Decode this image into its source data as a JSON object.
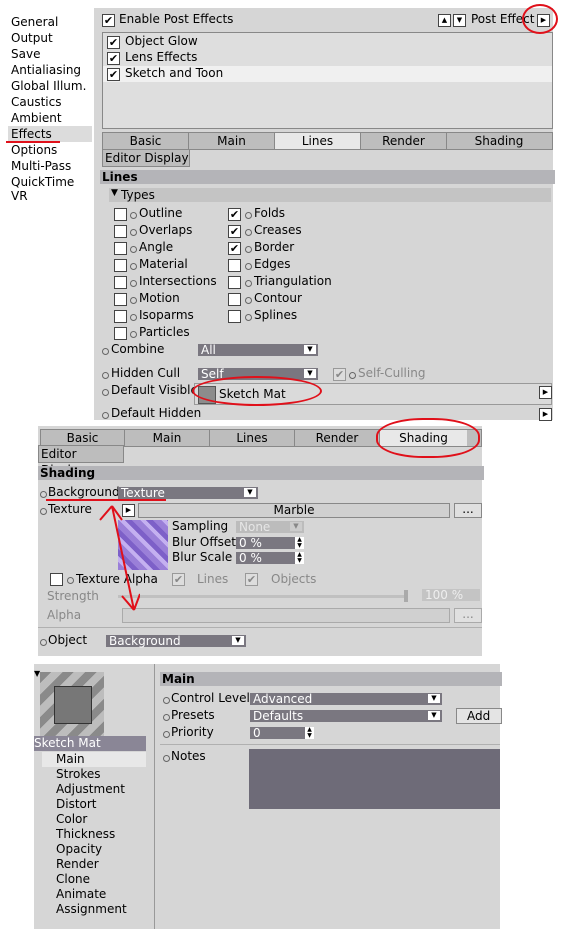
{
  "panel1": {
    "sidebar": [
      "General",
      "Output",
      "Save",
      "Antialiasing",
      "Global Illum.",
      "Caustics",
      "Ambient Occl.",
      "Effects",
      "Options",
      "Multi-Pass",
      "QuickTime VR"
    ],
    "enable_post_effects": "Enable Post Effects",
    "post_effect_label": "Post Effect",
    "effects_list": [
      "Object Glow",
      "Lens Effects",
      "Sketch and Toon"
    ],
    "tabs": [
      "Basic",
      "Main",
      "Lines",
      "Render",
      "Shading"
    ],
    "editor_display": "Editor Display",
    "section_title": "Lines",
    "types_label": "Types",
    "types_col1": [
      "Outline",
      "Overlaps",
      "Angle",
      "Material",
      "Intersections",
      "Motion",
      "Isoparms",
      "Particles"
    ],
    "types_col2": [
      "Folds",
      "Creases",
      "Border",
      "Edges",
      "Triangulation",
      "Contour",
      "Splines"
    ],
    "combine_label": "Combine",
    "combine_value": "All",
    "hidden_cull_label": "Hidden Cull",
    "hidden_cull_value": "Self",
    "self_culling": "Self-Culling",
    "default_visible_label": "Default Visible",
    "default_visible_value": "Sketch Mat",
    "default_hidden_label": "Default Hidden"
  },
  "panel2": {
    "tabs": [
      "Basic",
      "Main",
      "Lines",
      "Render",
      "Shading"
    ],
    "editor_display": "Editor Display",
    "section_title": "Shading",
    "background_label": "Background",
    "background_value": "Texture",
    "texture_label": "Texture",
    "texture_value": "Marble",
    "ellipsis": "...",
    "sampling_label": "Sampling",
    "sampling_value": "None",
    "blur_offset_label": "Blur Offset",
    "blur_offset_value": "0 %",
    "blur_scale_label": "Blur Scale",
    "blur_scale_value": "0 %",
    "texture_alpha": "Texture Alpha",
    "lines_label": "Lines",
    "objects_label": "Objects",
    "strength_label": "Strength",
    "strength_value": "100 %",
    "alpha_label": "Alpha",
    "object_label": "Object",
    "object_value": "Background"
  },
  "panel3": {
    "material_name": "Sketch Mat",
    "channels": [
      "Main",
      "Strokes",
      "Adjustment",
      "Distort",
      "Color",
      "Thickness",
      "Opacity",
      "Render",
      "Clone",
      "Animate",
      "Assignment"
    ],
    "section_title": "Main",
    "control_level_label": "Control Level",
    "control_level_value": "Advanced",
    "presets_label": "Presets",
    "presets_value": "Defaults",
    "add_preset": "Add P",
    "priority_label": "Priority",
    "priority_value": "0",
    "notes_label": "Notes"
  },
  "colors": {
    "panel_bg": "#d6d6d6",
    "header_bg": "#b4b4b8",
    "field_bg": "#7a7780",
    "annotation": "#e0101a"
  }
}
